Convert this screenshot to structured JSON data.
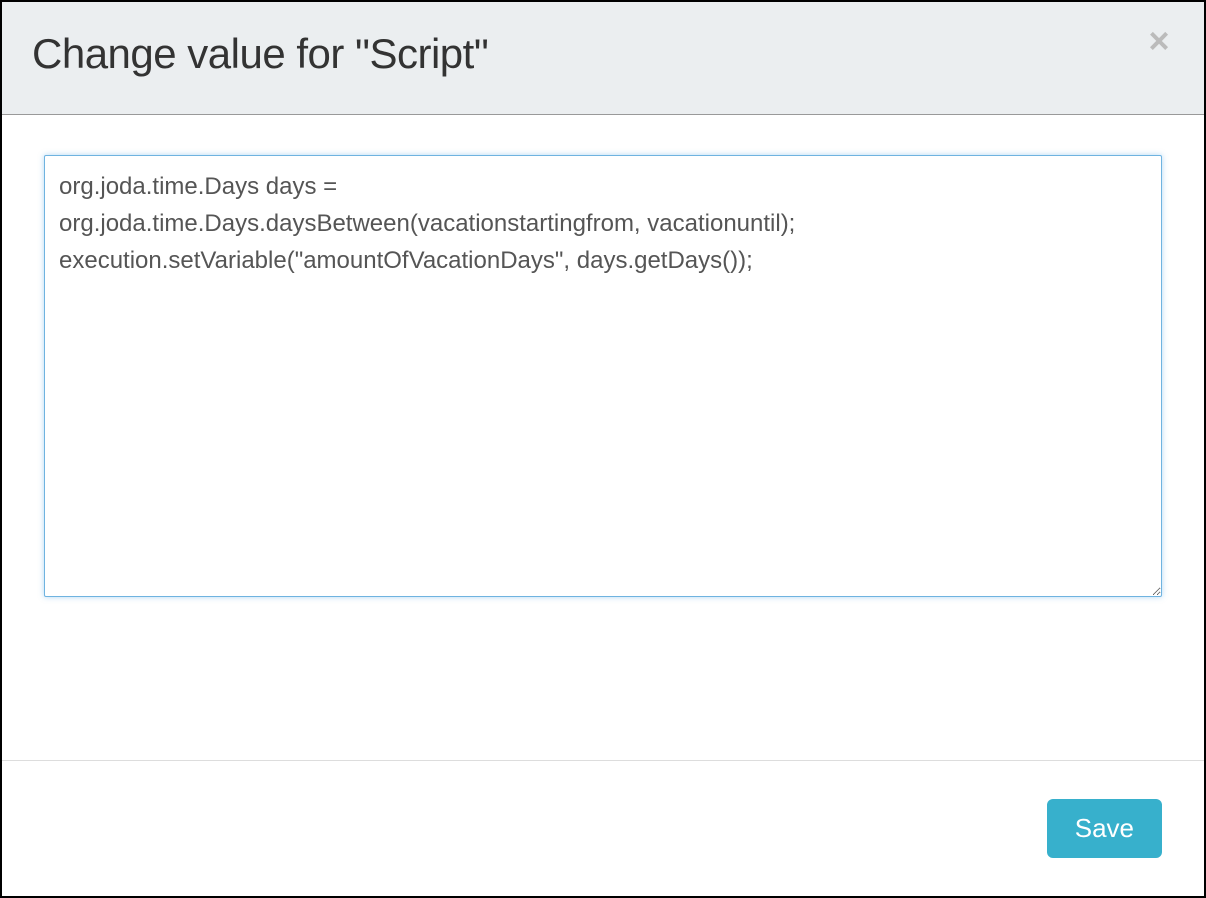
{
  "modal": {
    "title": "Change value for \"Script\"",
    "script_value": "org.joda.time.Days days =\norg.joda.time.Days.daysBetween(vacationstartingfrom, vacationuntil);\nexecution.setVariable(\"amountOfVacationDays\", days.getDays());",
    "save_label": "Save",
    "close_label": "×"
  }
}
